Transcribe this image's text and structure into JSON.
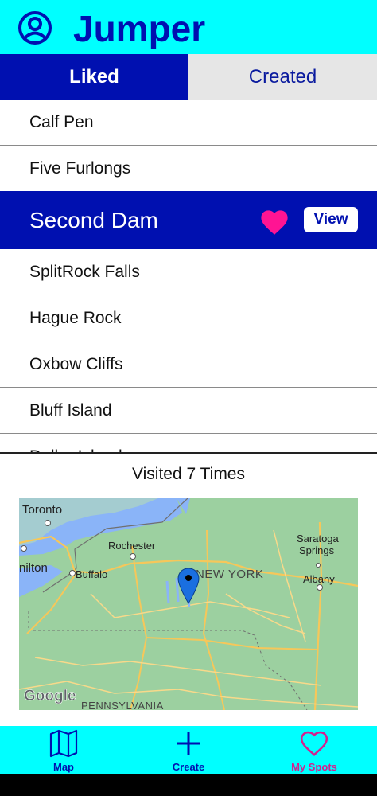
{
  "app": {
    "title": "Jumper"
  },
  "tabs": {
    "liked": "Liked",
    "created": "Created"
  },
  "spots": [
    "Calf Pen",
    "Five Furlongs",
    "Second Dam",
    "SplitRock Falls",
    "Hague Rock",
    "Oxbow Cliffs",
    "Bluff Island",
    "Dollar Island"
  ],
  "selected": {
    "view_label": "View",
    "visited_text": "Visited 7 Times"
  },
  "map": {
    "labels": {
      "toronto": "Toronto",
      "rochester": "Rochester",
      "buffalo": "Buffalo",
      "hamilton": "nilton",
      "saratoga1": "Saratoga",
      "saratoga2": "Springs",
      "newyork": "NEW YORK",
      "albany": "Albany",
      "pennsylvania": "PENNSYLVANIA",
      "google": "Google"
    }
  },
  "nav": {
    "map": "Map",
    "create": "Create",
    "myspots": "My Spots"
  },
  "colors": {
    "accent": "#0010b0",
    "header_bg": "#00ffff",
    "heart": "#ff1493",
    "myspots": "#d4208f"
  }
}
